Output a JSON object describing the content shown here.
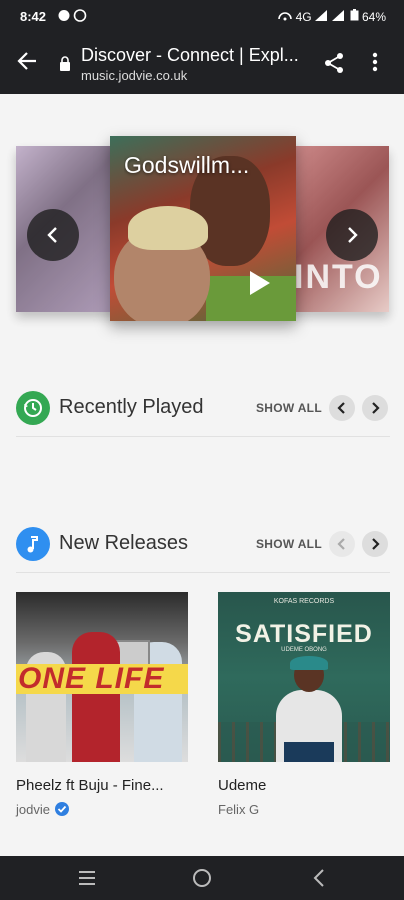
{
  "status_bar": {
    "time": "8:42",
    "right_icons": "4G",
    "battery": "64%"
  },
  "browser": {
    "title": "Discover - Connect | Expl...",
    "url": "music.jodvie.co.uk"
  },
  "carousel": {
    "current_title": "Godswillm...",
    "left_partial_text": "",
    "right_partial_text": "INTO"
  },
  "sections": {
    "recent": {
      "title": "Recently Played",
      "show_all": "SHOW ALL",
      "icon": "history-icon",
      "color": "#34a853"
    },
    "new": {
      "title": "New Releases",
      "show_all": "SHOW ALL",
      "icon": "music-note-icon",
      "color": "#2f8ff0"
    }
  },
  "releases": [
    {
      "title": "Pheelz ft Buju - Fine...",
      "artist": "jodvie",
      "verified": true,
      "cover_text": "ONE LIFE"
    },
    {
      "title": "Udeme",
      "artist": "Felix G",
      "verified": false,
      "cover_text": "SATISFIED",
      "cover_small_top": "KOFAS RECORDS",
      "cover_small_bottom": "UDEME OBONG"
    }
  ],
  "colors": {
    "bar": "#202124",
    "page_bg": "#f4f4f4",
    "verified": "#2f7fe0"
  }
}
